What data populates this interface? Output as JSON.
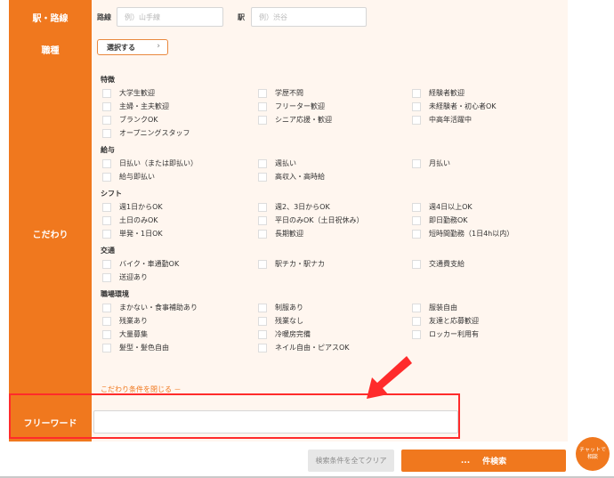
{
  "station": {
    "label": "駅・路線",
    "line_label": "路線",
    "line_placeholder": "例）山手線",
    "station_label": "駅",
    "station_placeholder": "例）渋谷"
  },
  "job": {
    "label": "職種",
    "select_button": "選択する"
  },
  "kodawari": {
    "label": "こだわり",
    "groups": [
      {
        "title": "特徴",
        "items": [
          "大学生歓迎",
          "学歴不問",
          "経験者歓迎",
          "主婦・主夫歓迎",
          "フリーター歓迎",
          "未経験者・初心者OK",
          "ブランクOK",
          "シニア応援・歓迎",
          "中高年活躍中",
          "オープニングスタッフ"
        ]
      },
      {
        "title": "給与",
        "items": [
          "日払い（または即払い）",
          "週払い",
          "月払い",
          "給与即払い",
          "高収入・高時給"
        ]
      },
      {
        "title": "シフト",
        "items": [
          "週1日からOK",
          "週2、3日からOK",
          "週4日以上OK",
          "土日のみOK",
          "平日のみOK（土日祝休み）",
          "即日勤務OK",
          "単発・1日OK",
          "長期歓迎",
          "短時間勤務（1日4h以内）"
        ]
      },
      {
        "title": "交通",
        "items": [
          "バイク・車通勤OK",
          "駅チカ・駅ナカ",
          "交通費支給",
          "送迎あり"
        ]
      },
      {
        "title": "職場環境",
        "items": [
          "まかない・食事補助あり",
          "制服あり",
          "服装自由",
          "残業あり",
          "残業なし",
          "友達と応募歓迎",
          "大量募集",
          "冷暖房完備",
          "ロッカー利用有",
          "髪型・髪色自由",
          "ネイル自由・ピアスOK"
        ]
      }
    ],
    "close_link": "こだわり条件を閉じる －"
  },
  "freeword": {
    "label": "フリーワード",
    "value": ""
  },
  "actions": {
    "clear": "検索条件を全てクリア",
    "count": "...",
    "search": "件検索"
  },
  "chat": {
    "line1": "チャットで",
    "line2": "相談"
  },
  "colors": {
    "accent": "#f0781e",
    "highlight": "#ff2b2b",
    "panel": "#fff6ef"
  }
}
